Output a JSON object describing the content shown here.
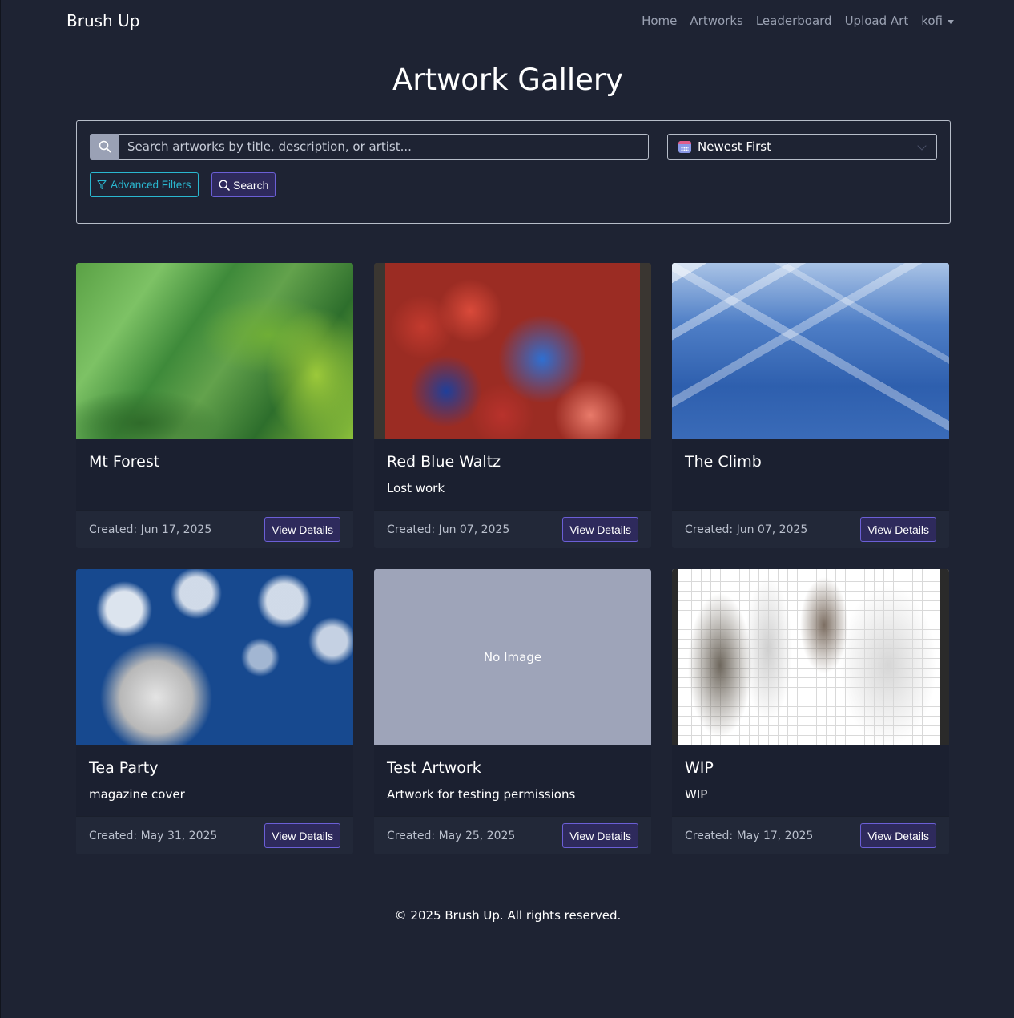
{
  "nav": {
    "brand": "Brush Up",
    "links": [
      "Home",
      "Artworks",
      "Leaderboard",
      "Upload Art"
    ],
    "user": "kofi"
  },
  "page": {
    "title": "Artwork Gallery"
  },
  "filters": {
    "search_placeholder": "Search artworks by title, description, or artist...",
    "sort_selected": "Newest First",
    "advanced_label": "Advanced Filters",
    "search_label": "Search"
  },
  "artworks": [
    {
      "title": "Mt Forest",
      "description": "",
      "created": "Created: Jun 17, 2025",
      "button": "View Details"
    },
    {
      "title": "Red Blue Waltz",
      "description": "Lost work",
      "created": "Created: Jun 07, 2025",
      "button": "View Details"
    },
    {
      "title": "The Climb",
      "description": "",
      "created": "Created: Jun 07, 2025",
      "button": "View Details"
    },
    {
      "title": "Tea Party",
      "description": "magazine cover",
      "created": "Created: May 31, 2025",
      "button": "View Details"
    },
    {
      "title": "Test Artwork",
      "description": "Artwork for testing permissions",
      "created": "Created: May 25, 2025",
      "button": "View Details",
      "no_image": "No Image"
    },
    {
      "title": "WIP",
      "description": "WIP",
      "created": "Created: May 17, 2025",
      "button": "View Details"
    }
  ],
  "footer": {
    "text": "© 2025 Brush Up. All rights reserved."
  },
  "colors": {
    "background": "#1e2333",
    "accent": "#6b5fd6",
    "info": "#2ab7cf"
  }
}
